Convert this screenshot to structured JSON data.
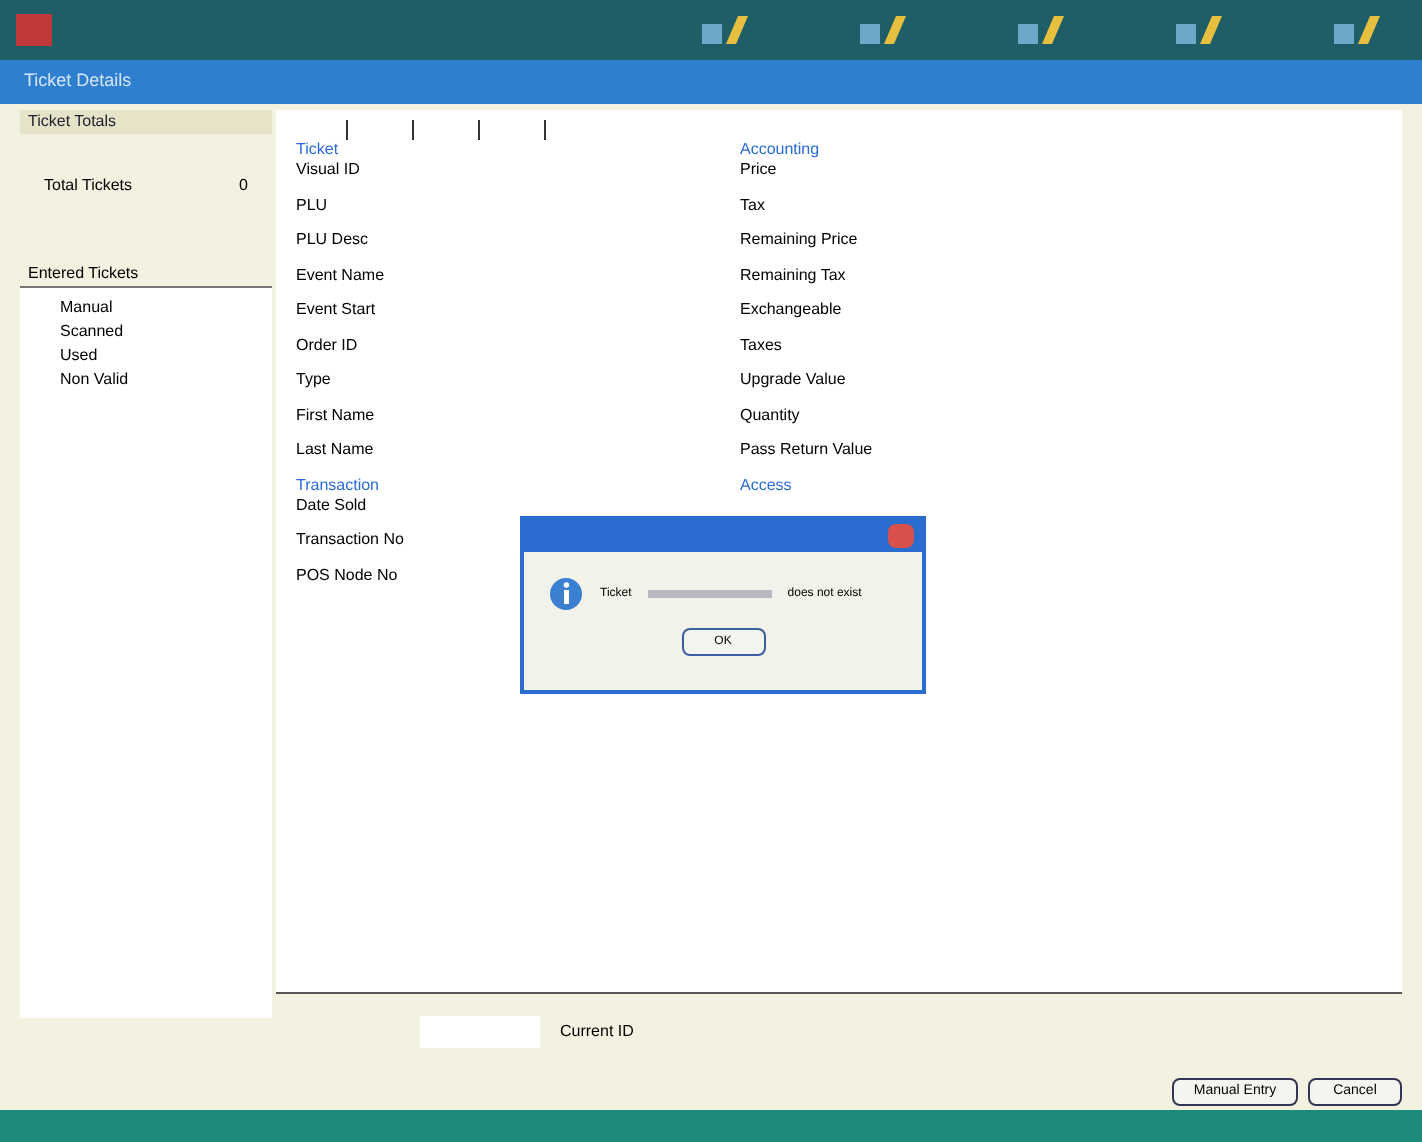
{
  "window": {
    "title": "Ticket Details"
  },
  "totals": {
    "header": "Ticket Totals",
    "label": "Total Tickets",
    "value": "0"
  },
  "entered": {
    "header": "Entered Tickets",
    "items": [
      "Manual",
      "Scanned",
      "Used",
      "Non Valid"
    ]
  },
  "detail_columns": [
    {
      "sections": [
        {
          "heading": "Ticket",
          "fields": [
            "Visual ID",
            "PLU",
            "PLU Desc",
            "Event Name",
            "Event Start",
            "Order ID",
            "Type",
            "First Name",
            "Last Name"
          ]
        },
        {
          "heading": "Transaction",
          "fields": [
            "Date Sold",
            "Transaction No",
            "POS Node No"
          ]
        }
      ]
    },
    {
      "sections": [
        {
          "heading": "Accounting",
          "fields": [
            "Price",
            "Tax",
            "Remaining Price",
            "Remaining Tax",
            "Exchangeable",
            "Taxes",
            "Upgrade Value",
            "Quantity",
            "Pass Return Value"
          ]
        },
        {
          "heading": "Access"
        }
      ]
    }
  ],
  "current_id": {
    "label": "Current ID"
  },
  "buttons": [
    "Manual Entry",
    "Cancel"
  ],
  "dialog": {
    "message_start": "Ticket",
    "message_end": "does not exist",
    "button": "OK"
  }
}
